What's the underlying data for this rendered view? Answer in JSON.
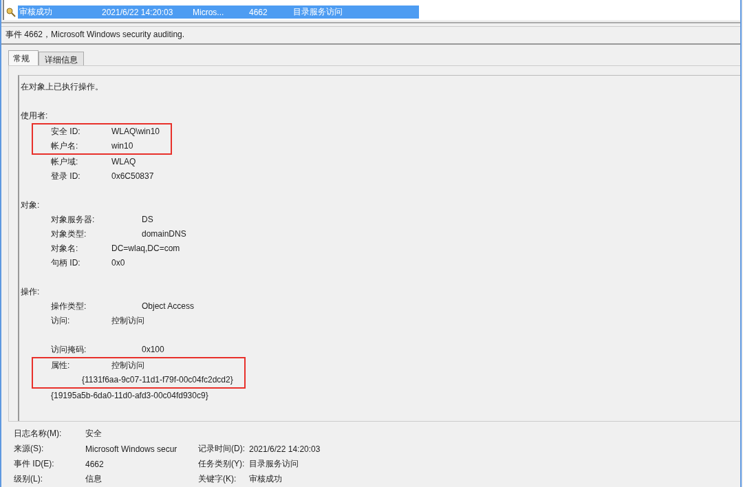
{
  "event_list": {
    "rows": [
      {
        "cells": [
          "审核成功",
          "2021/6/22 14:20:03",
          "Micros...",
          "4662",
          "目录服务访问"
        ],
        "selected": true
      }
    ]
  },
  "event_title": "事件 4662，Microsoft Windows security auditing.",
  "tabs": [
    {
      "label": "常规",
      "selected": true
    },
    {
      "label": "详细信息",
      "selected": false
    }
  ],
  "description": {
    "summary": "在对象上已执行操作。",
    "sections": [
      {
        "heading": "使用者:",
        "rows": [
          {
            "kind": "pair",
            "label": "安全 ID:",
            "value": "WLAQ\\win10",
            "highlighted": true
          },
          {
            "kind": "pair",
            "label": "帐户名:",
            "value": "win10",
            "highlighted": true
          },
          {
            "kind": "pair",
            "label": "帐户域:",
            "value": "WLAQ",
            "highlighted": false
          },
          {
            "kind": "pair",
            "label": "登录 ID:",
            "value": "0x6C50837",
            "highlighted": false
          }
        ]
      },
      {
        "heading": "对象:",
        "rows": [
          {
            "kind": "wide",
            "label": "对象服务器:",
            "value": "DS",
            "highlighted": false
          },
          {
            "kind": "wide",
            "label": "对象类型:",
            "value": "domainDNS",
            "highlighted": false
          },
          {
            "kind": "pair",
            "label": "对象名:",
            "value": "DC=wlaq,DC=com",
            "highlighted": false
          },
          {
            "kind": "pair",
            "label": "句柄 ID:",
            "value": "0x0",
            "highlighted": false
          }
        ]
      },
      {
        "heading": "操作:",
        "rows": [
          {
            "kind": "wide",
            "label": "操作类型:",
            "value": "Object Access",
            "highlighted": false
          },
          {
            "kind": "pair",
            "label": "访问:",
            "value": "控制访问",
            "highlighted": false
          },
          {
            "kind": "gap"
          },
          {
            "kind": "wide",
            "label": "访问掩码:",
            "value": "0x100",
            "highlighted": false
          },
          {
            "kind": "pair",
            "label": "属性:",
            "value": "控制访问",
            "highlighted": true
          },
          {
            "kind": "indented",
            "value": "{1131f6aa-9c07-11d1-f79f-00c04fc2dcd2}",
            "highlighted": true
          },
          {
            "kind": "plain",
            "value": "{19195a5b-6da0-11d0-afd3-00c04fd930c9}",
            "highlighted": false
          }
        ]
      }
    ]
  },
  "details": [
    {
      "label": "日志名称(M):",
      "value": "安全"
    },
    {
      "label": "来源(S):",
      "value": "Microsoft Windows secur",
      "label_2": "记录时间(D):",
      "value_2": "2021/6/22 14:20:03"
    },
    {
      "label": "事件 ID(E):",
      "value": "4662",
      "label_2": "任务类别(Y):",
      "value_2": "目录服务访问"
    },
    {
      "label": "级别(L):",
      "value": "信息",
      "label_2": "关键字(K):",
      "value_2": "审核成功"
    }
  ]
}
